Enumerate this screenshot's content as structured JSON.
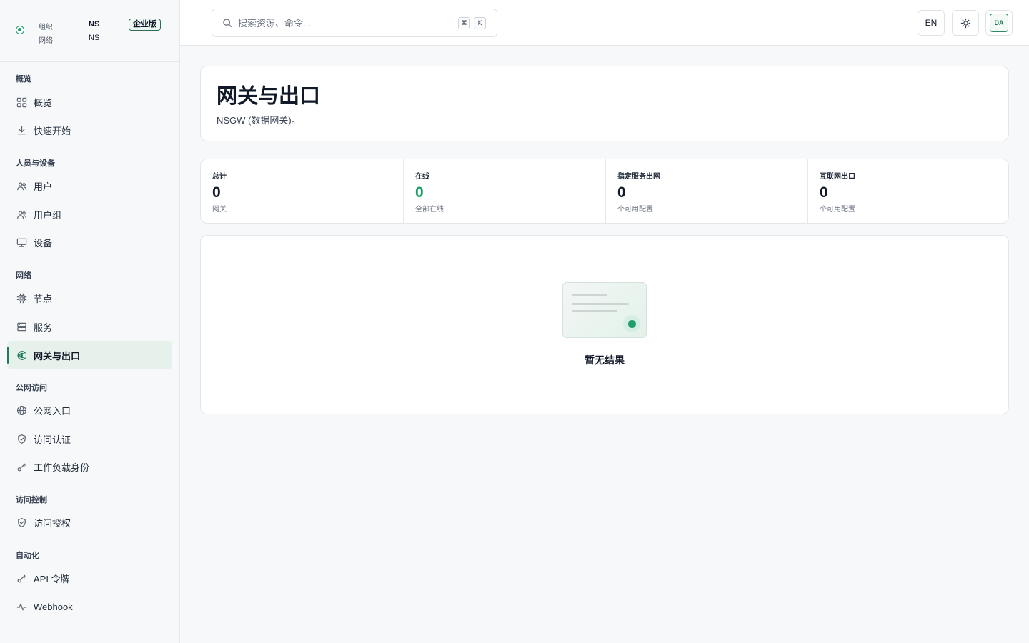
{
  "org": {
    "org_label": "组织",
    "org_value": "NS",
    "network_label": "网络",
    "network_value": "NS",
    "edition_badge": "企业版"
  },
  "sidebar": {
    "sections": {
      "overview": "概览",
      "people": "人员与设备",
      "network": "网络",
      "public": "公网访问",
      "access": "访问控制",
      "automation": "自动化"
    },
    "items": {
      "overview": "概览",
      "quickstart": "快速开始",
      "users": "用户",
      "user_groups": "用户组",
      "devices": "设备",
      "nodes": "节点",
      "services": "服务",
      "gateways": "网关与出口",
      "public_ingress": "公网入口",
      "access_auth": "访问认证",
      "workload_identity": "工作负载身份",
      "access_authz": "访问授权",
      "api_tokens": "API 令牌",
      "webhook": "Webhook"
    },
    "active_item": "gateways"
  },
  "topbar": {
    "search_placeholder": "搜索资源、命令...",
    "shortcut_mod": "⌘",
    "shortcut_key": "K",
    "lang_button": "EN",
    "avatar_initials": "DA"
  },
  "page": {
    "title": "网关与出口",
    "subtitle": "NSGW (数据网关)。"
  },
  "stats": [
    {
      "label": "总计",
      "value": "0",
      "sub": "网关"
    },
    {
      "label": "在线",
      "value": "0",
      "sub": "全部在线"
    },
    {
      "label": "指定服务出网",
      "value": "0",
      "sub": "个可用配置"
    },
    {
      "label": "互联网出口",
      "value": "0",
      "sub": "个可用配置"
    }
  ],
  "empty_state": {
    "message": "暂无结果"
  },
  "colors": {
    "accent": "#1f9d6a",
    "active_bg": "#e6f1ec",
    "page_bg": "#f6f8f9"
  }
}
